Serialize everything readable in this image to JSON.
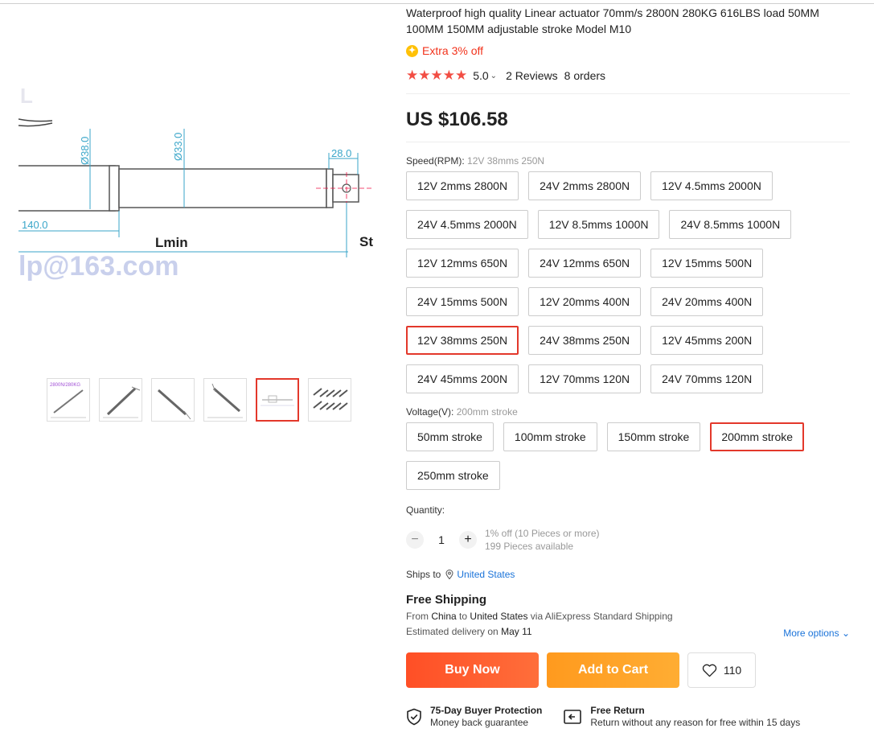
{
  "product": {
    "title": "Waterproof high quality Linear actuator 70mm/s 2800N 280KG 616LBS load 50MM 100MM 150MM adjustable stroke Model M10",
    "coupon": "Extra 3% off",
    "rating": "5.0",
    "reviews": "2 Reviews",
    "orders": "8 orders",
    "price": "US $106.58"
  },
  "gallery": {
    "image_labels": [
      "Ø38.0",
      "Ø33.0",
      "28.0",
      "140.0",
      "Lmin",
      "St",
      "lp@163.com"
    ],
    "thumb_label": "2800N/280KG",
    "thumbs_count": 6,
    "active_thumb": 4
  },
  "speed": {
    "label": "Speed(RPM):",
    "selected": "12V 38mms 250N",
    "options": [
      "12V 2mms 2800N",
      "24V 2mms 2800N",
      "12V 4.5mms 2000N",
      "24V 4.5mms 2000N",
      "12V 8.5mms 1000N",
      "24V 8.5mms 1000N",
      "12V 12mms 650N",
      "24V 12mms 650N",
      "12V 15mms 500N",
      "24V 15mms 500N",
      "12V 20mms 400N",
      "24V 20mms 400N",
      "12V 38mms 250N",
      "24V 38mms 250N",
      "12V 45mms 200N",
      "24V 45mms 200N",
      "12V 70mms 120N",
      "24V 70mms 120N"
    ]
  },
  "voltage": {
    "label": "Voltage(V):",
    "selected": "200mm stroke",
    "options": [
      "50mm stroke",
      "100mm stroke",
      "150mm stroke",
      "200mm stroke",
      "250mm stroke"
    ]
  },
  "quantity": {
    "label": "Quantity:",
    "value": "1",
    "discount": "1% off (10 Pieces or more)",
    "available": "199 Pieces available"
  },
  "shipping": {
    "ships_to_label": "Ships to",
    "destination": "United States",
    "title": "Free Shipping",
    "from_label": "From",
    "from": "China",
    "to_label": "to",
    "to": "United States",
    "via": "via AliExpress Standard Shipping",
    "estimated_label": "Estimated delivery on",
    "estimated_date": "May 11",
    "more_options": "More options"
  },
  "actions": {
    "buy_now": "Buy Now",
    "add_to_cart": "Add to Cart",
    "wishlist_count": "110"
  },
  "guarantees": {
    "protection_title": "75-Day Buyer Protection",
    "protection_sub": "Money back guarantee",
    "return_title": "Free Return",
    "return_sub": "Return without any reason for free within 15 days"
  },
  "colors": {
    "accent": "#e3382b",
    "buy": "#ff4f26",
    "cart": "#ff9a1e",
    "link": "#1a73d9",
    "star": "#f24d43"
  }
}
